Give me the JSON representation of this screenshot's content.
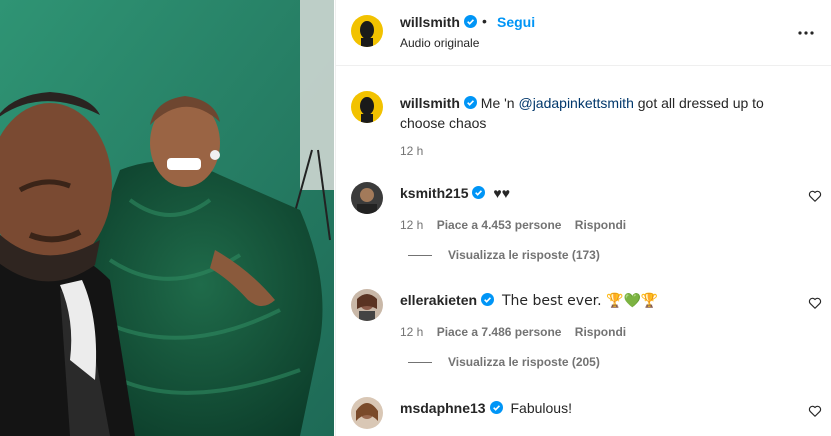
{
  "post": {
    "username": "willsmith",
    "dot": "•",
    "follow_label": "Segui",
    "audio": "Audio originale",
    "caption": {
      "username": "willsmith",
      "text_before": "Me 'n ",
      "mention": "@jadapinkettsmith",
      "text_after": " got all dressed up to choose chaos",
      "time": "12 h"
    }
  },
  "comments": [
    {
      "username": "ksmith215",
      "text": "♥♥",
      "time": "12 h",
      "likes": "Piace a 4.453 persone",
      "reply_label": "Rispondi",
      "replies_label": "Visualizza le risposte (173)"
    },
    {
      "username": "ellerakieten",
      "text": "The best ever. 🏆💚🏆",
      "time": "12 h",
      "likes": "Piace a 7.486 persone",
      "reply_label": "Rispondi",
      "replies_label": "Visualizza le risposte (205)"
    },
    {
      "username": "msdaphne13",
      "text": "Fabulous!"
    }
  ],
  "icons": {
    "verified": "verified-badge-icon",
    "more": "more-options-icon",
    "heart": "heart-outline-icon"
  },
  "colors": {
    "accent": "#0095f6",
    "verified": "#0095f6",
    "muted": "#737373",
    "mention": "#00376b"
  }
}
